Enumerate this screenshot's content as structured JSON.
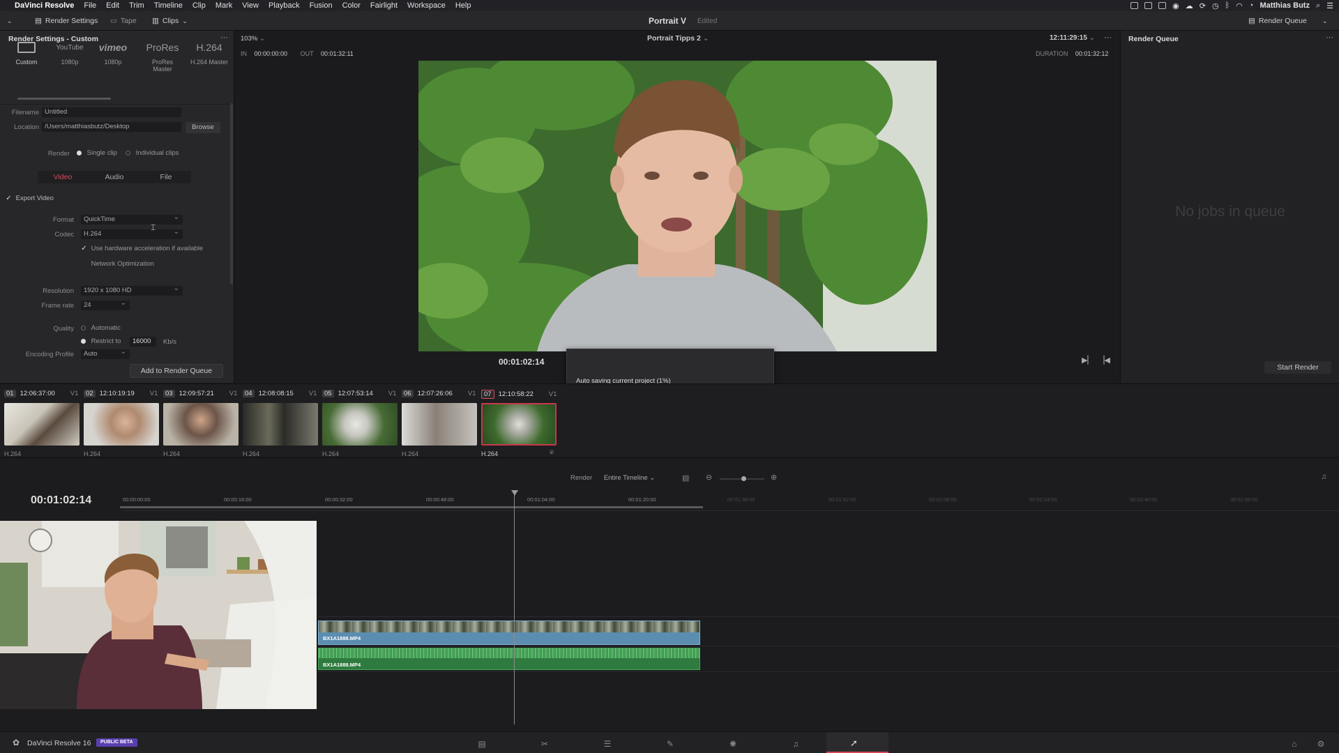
{
  "menubar": {
    "app_name": "DaVinci Resolve",
    "items": [
      "File",
      "Edit",
      "Trim",
      "Timeline",
      "Clip",
      "Mark",
      "View",
      "Playback",
      "Fusion",
      "Color",
      "Fairlight",
      "Workspace",
      "Help"
    ],
    "user": "Matthias Butz"
  },
  "toolbar": {
    "render_settings": "Render Settings",
    "tape": "Tape",
    "clips": "Clips",
    "project_title": "Portrait V",
    "project_status": "Edited",
    "render_queue": "Render Queue"
  },
  "render_settings": {
    "title": "Render Settings - Custom",
    "presets": [
      {
        "label": "",
        "sub": "Custom"
      },
      {
        "label": "YouTube",
        "sub": "1080p"
      },
      {
        "label": "vimeo",
        "sub": "1080p"
      },
      {
        "label": "ProRes",
        "sub": "ProRes Master"
      },
      {
        "label": "H.264",
        "sub": "H.264 Master"
      }
    ],
    "filename_label": "Filename",
    "filename_value": "Untitled",
    "location_label": "Location",
    "location_value": "/Users/matthiasbutz/Desktop",
    "browse": "Browse",
    "render_label": "Render",
    "single_clip": "Single clip",
    "individual_clips": "Individual clips",
    "tabs": [
      "Video",
      "Audio",
      "File"
    ],
    "export_video": "Export Video",
    "format_label": "Format",
    "format_value": "QuickTime",
    "codec_label": "Codec",
    "codec_value": "H.264",
    "hw_accel": "Use hardware acceleration if available",
    "network_opt": "Network Optimization",
    "resolution_label": "Resolution",
    "resolution_value": "1920 x 1080 HD",
    "framerate_label": "Frame rate",
    "framerate_value": "24",
    "quality_label": "Quality",
    "automatic": "Automatic",
    "restrict_to": "Restrict to",
    "bitrate": "16000",
    "bitrate_unit": "Kb/s",
    "encoding_label": "Encoding Profile",
    "encoding_value": "Auto",
    "add_to_queue": "Add to Render Queue"
  },
  "viewer": {
    "zoom": "103%",
    "timeline_name": "Portrait Tipps 2",
    "timecode_top": "12:11:29:15",
    "in_label": "IN",
    "in_tc": "00:00:00:00",
    "out_label": "OUT",
    "out_tc": "00:01:32:11",
    "duration_label": "DURATION",
    "duration_tc": "00:01:32:12",
    "current_tc": "00:01:02:14"
  },
  "render_queue": {
    "title": "Render Queue",
    "empty": "No jobs in queue",
    "start": "Start Render"
  },
  "dialog": {
    "message": "Auto saving current project  (1%)",
    "progress": 0.01
  },
  "clips": [
    {
      "num": "01",
      "tc": "12:06:37:00",
      "track": "V1",
      "codec": "H.264"
    },
    {
      "num": "02",
      "tc": "12:10:19:19",
      "track": "V1",
      "codec": "H.264"
    },
    {
      "num": "03",
      "tc": "12:09:57:21",
      "track": "V1",
      "codec": "H.264"
    },
    {
      "num": "04",
      "tc": "12:08:08:15",
      "track": "V1",
      "codec": "H.264"
    },
    {
      "num": "05",
      "tc": "12:07:53:14",
      "track": "V1",
      "codec": "H.264"
    },
    {
      "num": "06",
      "tc": "12:07:26:06",
      "track": "V1",
      "codec": "H.264"
    },
    {
      "num": "07",
      "tc": "12:10:58:22",
      "track": "V1",
      "codec": "H.264"
    }
  ],
  "timeline": {
    "render_label": "Render",
    "render_range": "Entire Timeline",
    "current_tc": "00:01:02:14",
    "ruler": [
      "00:00:00:00",
      "00:00:16:00",
      "00:00:32:00",
      "00:00:48:00",
      "00:01:04:00",
      "00:01:20:00",
      "00:01:36:00",
      "00:01:52:00",
      "00:02:08:00",
      "00:02:24:00",
      "00:02:40:00",
      "00:02:56:00"
    ],
    "video_clip": "BX1A1888.MP4",
    "audio_clip": "BX1A1888.MP4"
  },
  "bottombar": {
    "app": "DaVinci Resolve 16",
    "badge": "PUBLIC BETA"
  }
}
